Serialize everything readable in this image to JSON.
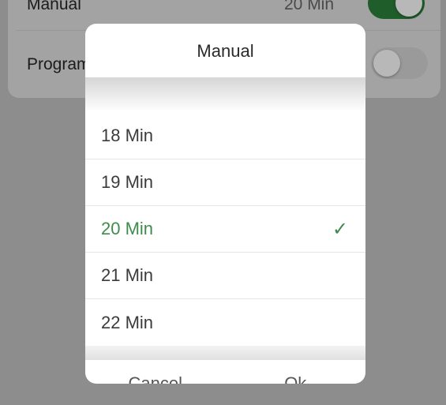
{
  "background": {
    "row1": {
      "label": "Manual",
      "value": "20 Min",
      "enabled": true
    },
    "row2": {
      "label": "Program",
      "enabled": false
    }
  },
  "dialog": {
    "title": "Manual",
    "options": [
      {
        "label": "18 Min",
        "selected": false
      },
      {
        "label": "19 Min",
        "selected": false
      },
      {
        "label": "20 Min",
        "selected": true
      },
      {
        "label": "21 Min",
        "selected": false
      },
      {
        "label": "22 Min",
        "selected": false
      }
    ],
    "check_glyph": "✓",
    "cancel_label": "Cancel",
    "ok_label": "Ok"
  },
  "colors": {
    "accent": "#3e8c4c",
    "overlay": "#8d8d8d"
  }
}
